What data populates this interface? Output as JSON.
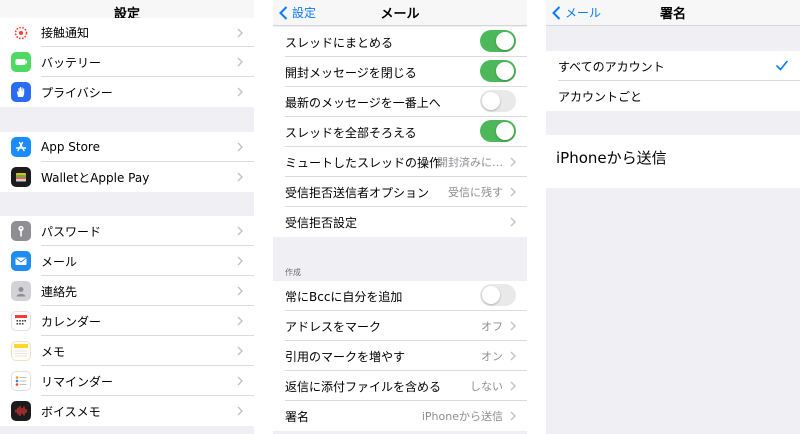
{
  "settings": {
    "title": "設定",
    "colors": {
      "partial": "#ff3b30",
      "battery": "#4cd964",
      "privacy": "#2a6df4",
      "appstore": "#1a8cff",
      "wallet": "#1c1c1e",
      "password": "#8e8e93",
      "mail": "#1f8cf2",
      "contacts": "#c7c7cc",
      "calendar": "#ffffff",
      "notes": "#ffd62c",
      "reminders": "#ffffff",
      "voicememo": "#1c1c1e"
    },
    "group1": [
      {
        "label": "接触通知",
        "icon": "exposure-notification-icon"
      },
      {
        "label": "バッテリー",
        "icon": "battery-icon"
      },
      {
        "label": "プライバシー",
        "icon": "hand-icon"
      }
    ],
    "group2": [
      {
        "label": "App Store",
        "icon": "app-store-icon"
      },
      {
        "label": "WalletとApple Pay",
        "icon": "wallet-icon"
      }
    ],
    "group3": [
      {
        "label": "パスワード",
        "icon": "key-icon"
      },
      {
        "label": "メール",
        "icon": "envelope-icon"
      },
      {
        "label": "連絡先",
        "icon": "contacts-icon"
      },
      {
        "label": "カレンダー",
        "icon": "calendar-icon"
      },
      {
        "label": "メモ",
        "icon": "notes-icon"
      },
      {
        "label": "リマインダー",
        "icon": "reminders-icon"
      },
      {
        "label": "ボイスメモ",
        "icon": "waveform-icon"
      }
    ]
  },
  "mail": {
    "title": "メール",
    "back_label": "設定",
    "accent": "#0a7aff",
    "toggle_on_color": "#4cb85a",
    "group1": [
      {
        "label": "スレッドにまとめる",
        "type": "toggle",
        "on": true
      },
      {
        "label": "開封メッセージを閉じる",
        "type": "toggle",
        "on": true
      },
      {
        "label": "最新のメッセージを一番上へ",
        "type": "toggle",
        "on": false
      },
      {
        "label": "スレッドを全部そろえる",
        "type": "toggle",
        "on": true
      },
      {
        "label": "ミュートしたスレッドの操作",
        "type": "value",
        "value": "開封済みに…"
      },
      {
        "label": "受信拒否送信者オプション",
        "type": "value",
        "value": "受信に残す"
      },
      {
        "label": "受信拒否設定",
        "type": "value",
        "value": ""
      }
    ],
    "section_compose": "作成",
    "group2": [
      {
        "label": "常にBccに自分を追加",
        "type": "toggle",
        "on": false
      },
      {
        "label": "アドレスをマーク",
        "type": "value",
        "value": "オフ"
      },
      {
        "label": "引用のマークを増やす",
        "type": "value",
        "value": "オン"
      },
      {
        "label": "返信に添付ファイルを含める",
        "type": "value",
        "value": "しない"
      },
      {
        "label": "署名",
        "type": "value",
        "value": "iPhoneから送信"
      }
    ]
  },
  "signature": {
    "title": "署名",
    "back_label": "メール",
    "options": [
      {
        "label": "すべてのアカウント",
        "selected": true
      },
      {
        "label": "アカウントごと",
        "selected": false
      }
    ],
    "text": "iPhoneから送信"
  }
}
